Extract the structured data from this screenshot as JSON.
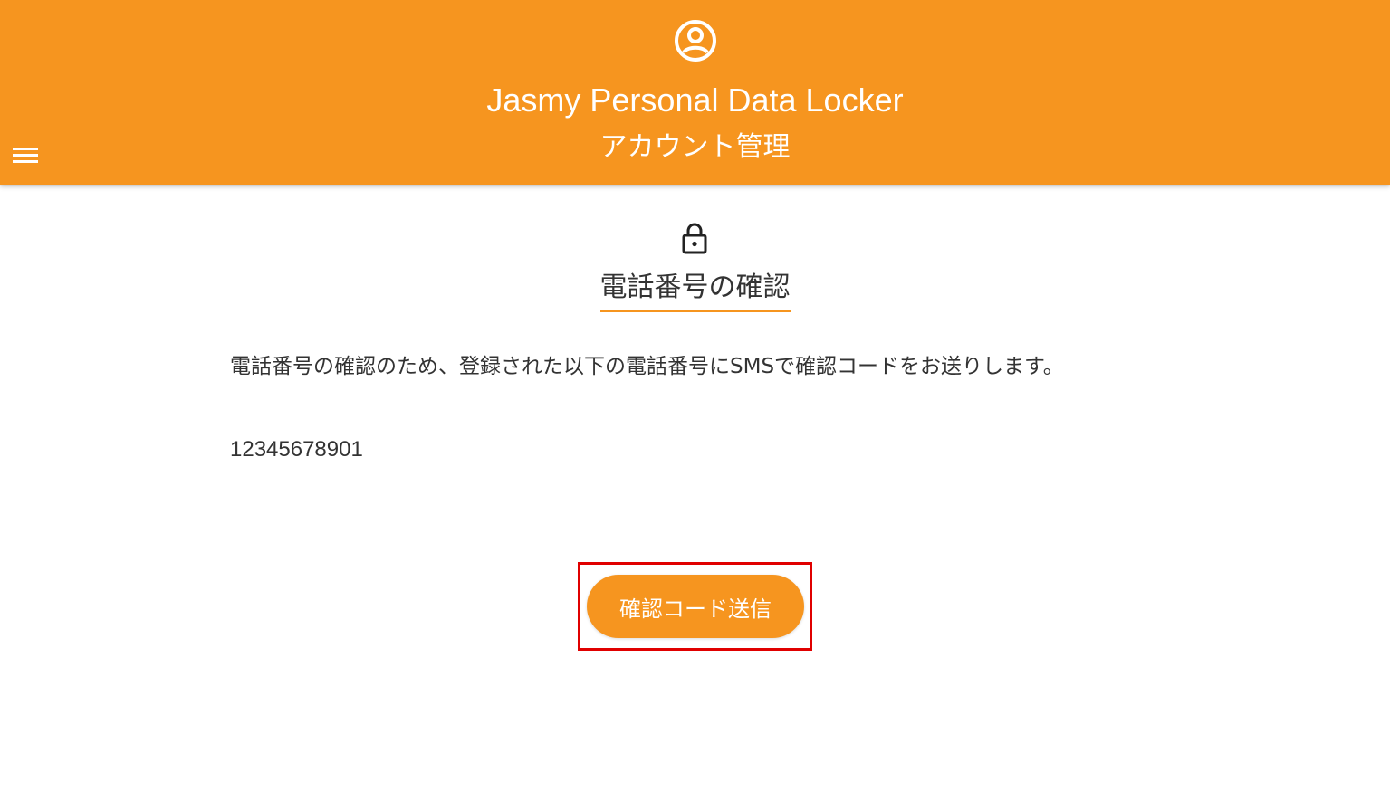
{
  "header": {
    "title": "Jasmy Personal Data Locker",
    "subtitle": "アカウント管理",
    "user_icon": "account-circle-icon",
    "menu_icon": "hamburger-menu-icon",
    "background_color": "#f6951f"
  },
  "main": {
    "lock_icon": "lock-icon",
    "section_title": "電話番号の確認",
    "description": "電話番号の確認のため、登録された以下の電話番号にSMSで確認コードをお送りします。",
    "phone_number": "12345678901",
    "send_button_label": "確認コード送信",
    "accent_color": "#f6951f",
    "highlight_color": "#e00000"
  }
}
